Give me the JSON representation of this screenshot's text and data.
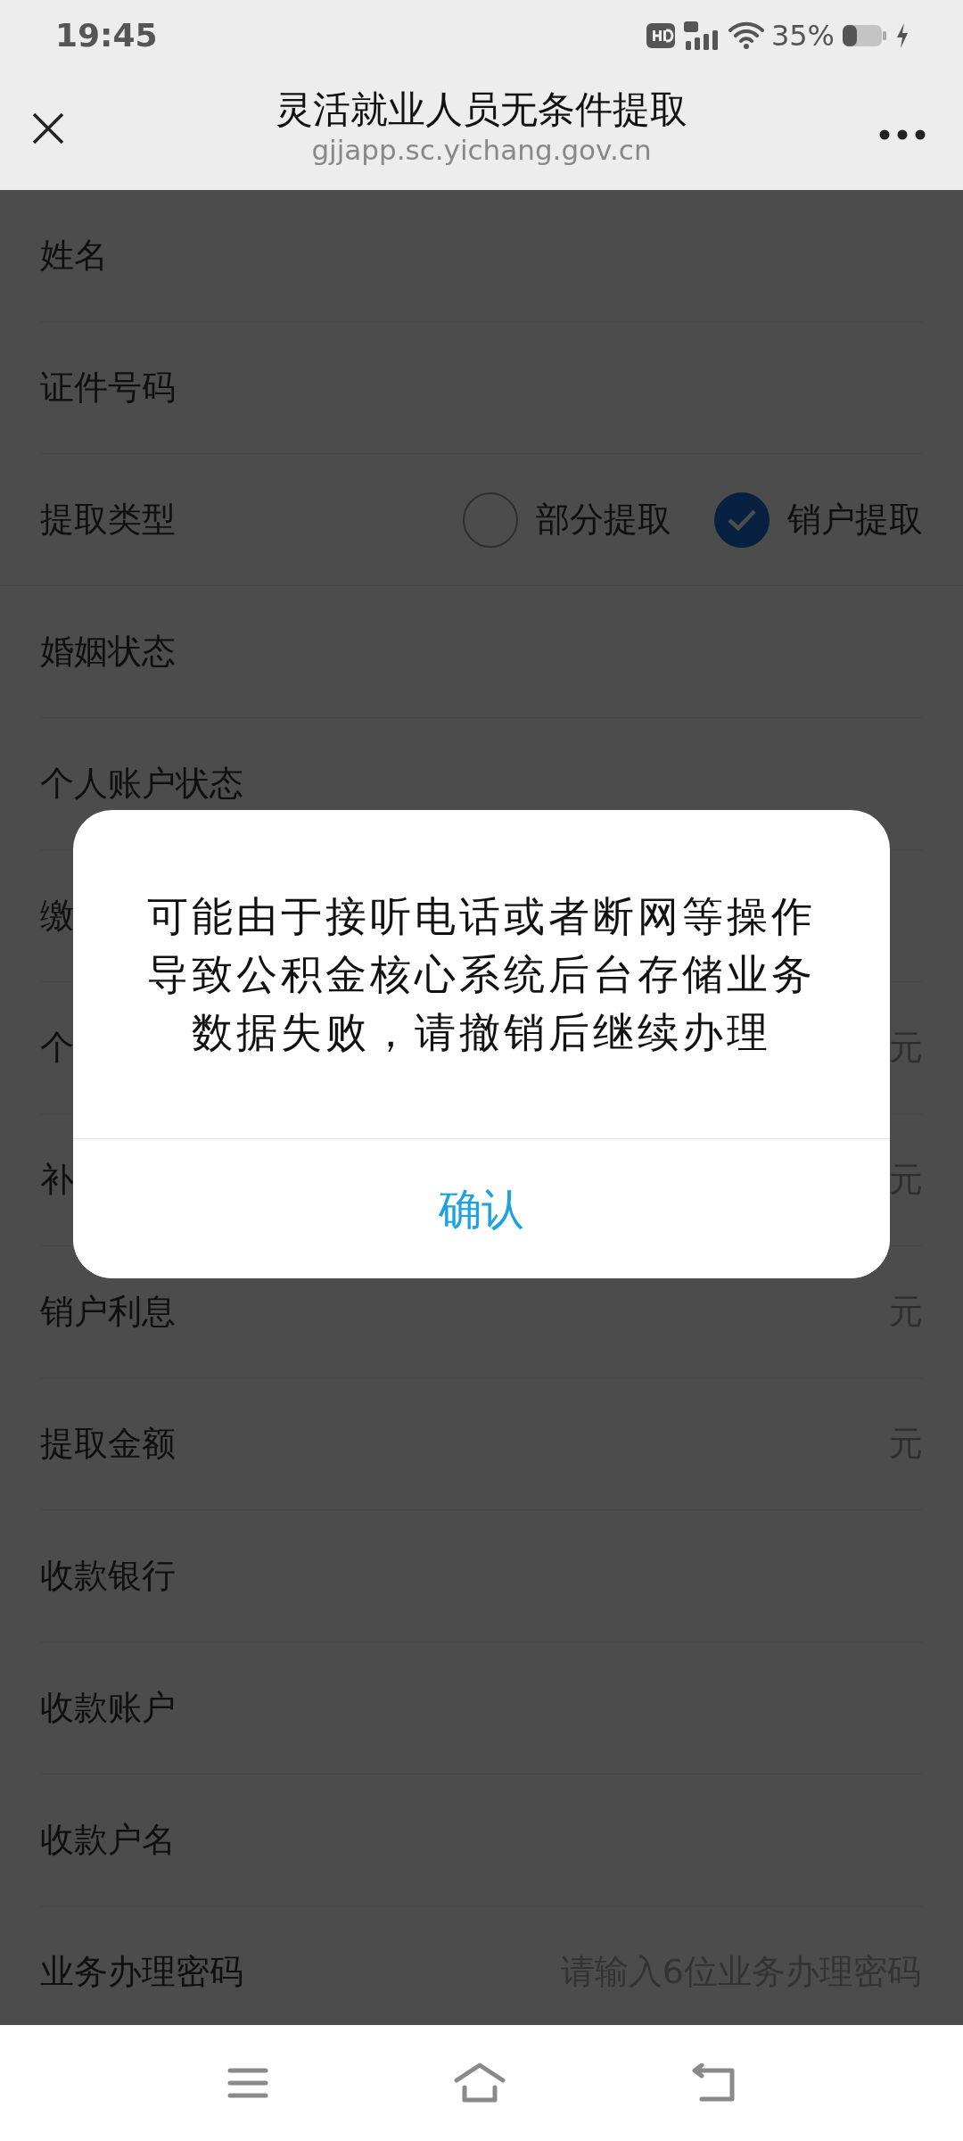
{
  "status_bar": {
    "time": "19:45",
    "battery_text": "35%"
  },
  "header": {
    "title": "灵活就业人员无条件提取",
    "url": "gjjapp.sc.yichang.gov.cn"
  },
  "form": {
    "rows": [
      {
        "kind": "text",
        "label": "姓名"
      },
      {
        "kind": "text",
        "label": "证件号码"
      },
      {
        "kind": "radio",
        "label": "提取类型",
        "options": [
          {
            "label": "部分提取",
            "selected": false
          },
          {
            "label": "销户提取",
            "selected": true
          }
        ]
      },
      {
        "kind": "text",
        "label": "婚姻状态"
      },
      {
        "kind": "text",
        "label": "个人账户状态"
      },
      {
        "kind": "text",
        "label": "缴"
      },
      {
        "kind": "text",
        "label": "个",
        "unit": "元"
      },
      {
        "kind": "text",
        "label": "补",
        "unit": "元"
      },
      {
        "kind": "text",
        "label": "销户利息",
        "unit": "元"
      },
      {
        "kind": "text",
        "label": "提取金额",
        "unit": "元"
      },
      {
        "kind": "text",
        "label": "收款银行"
      },
      {
        "kind": "text",
        "label": "收款账户"
      },
      {
        "kind": "text",
        "label": "收款户名"
      },
      {
        "kind": "input",
        "label": "业务办理密码",
        "placeholder": "请输入6位业务办理密码"
      }
    ]
  },
  "dialog": {
    "message": "可能由于接听电话或者断网等操作导致公积金核心系统后台存储业务数据失败，请撤销后继续办理",
    "button": "确认"
  }
}
